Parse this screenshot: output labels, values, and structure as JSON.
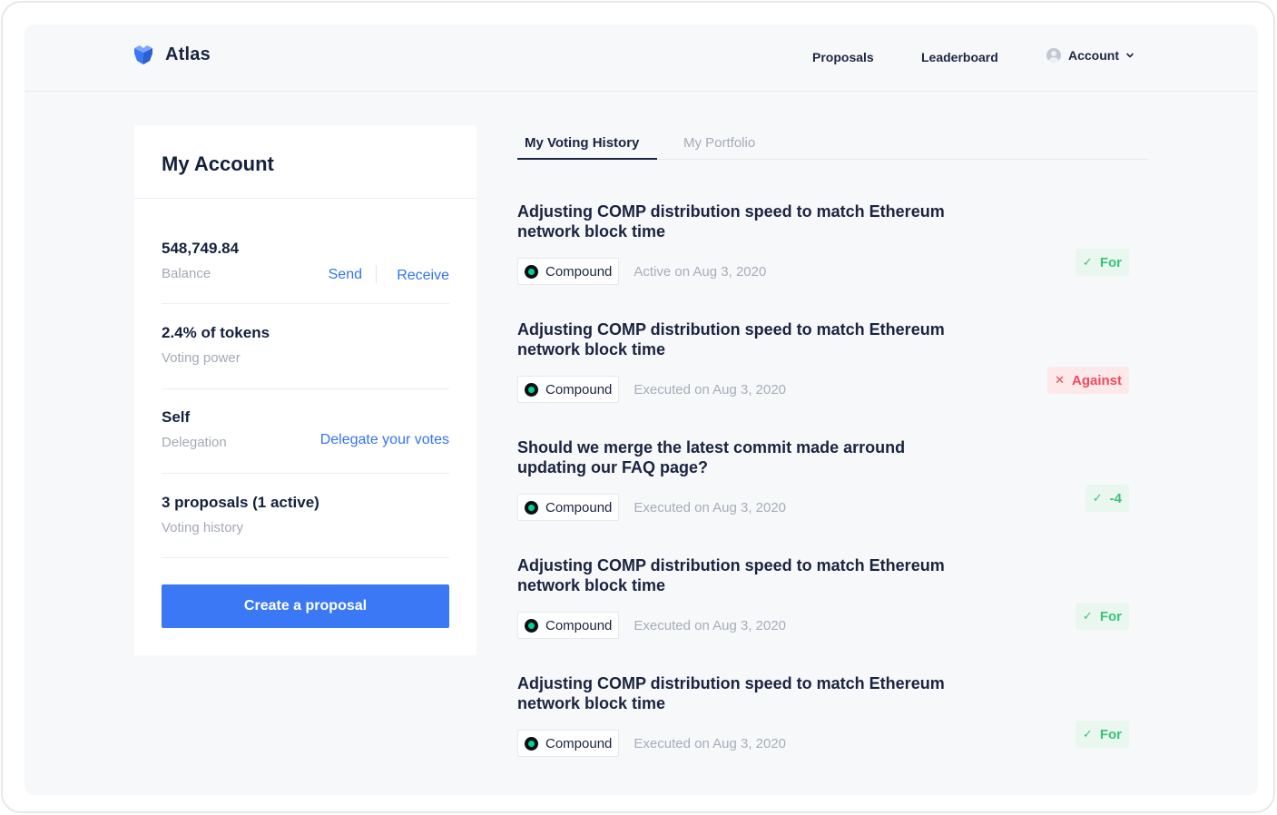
{
  "brand": {
    "name": "Atlas",
    "accent": "#3b78f6"
  },
  "nav": {
    "proposals": "Proposals",
    "leaderboard": "Leaderboard",
    "account": "Account"
  },
  "account_card": {
    "title": "My Account",
    "balance": {
      "value": "548,749.84",
      "label": "Balance",
      "send": "Send",
      "receive": "Receive"
    },
    "voting_power": {
      "value": "2.4% of tokens",
      "label": "Voting power"
    },
    "delegation": {
      "value": "Self",
      "label": "Delegation",
      "link": "Delegate your votes"
    },
    "history": {
      "value": "3 proposals (1 active)",
      "label": "Voting history"
    },
    "create_button": "Create a proposal"
  },
  "tabs": [
    {
      "label": "My Voting History",
      "active": true
    },
    {
      "label": "My Portfolio",
      "active": false
    }
  ],
  "proposals": [
    {
      "title": "Adjusting COMP distribution speed to match Ethereum network block time",
      "protocol": "Compound",
      "date": "Active on Aug 3, 2020",
      "vote": "For",
      "vote_type": "for",
      "vote_icon": "✓"
    },
    {
      "title": "Adjusting COMP distribution speed to match Ethereum network block time",
      "protocol": "Compound",
      "date": "Executed on Aug 3, 2020",
      "vote": "Against",
      "vote_type": "against",
      "vote_icon": "✕"
    },
    {
      "title": "Should we merge the latest commit made arround updating our FAQ page?",
      "protocol": "Compound",
      "date": "Executed on Aug 3, 2020",
      "vote": "-4",
      "vote_type": "for",
      "vote_icon": "✓"
    },
    {
      "title": "Adjusting COMP distribution speed to match Ethereum network block time",
      "protocol": "Compound",
      "date": "Executed on Aug 3, 2020",
      "vote": "For",
      "vote_type": "for",
      "vote_icon": "✓"
    },
    {
      "title": "Adjusting COMP distribution speed to match Ethereum network block time",
      "protocol": "Compound",
      "date": "Executed on Aug 3, 2020",
      "vote": "For",
      "vote_type": "for",
      "vote_icon": "✓"
    }
  ]
}
